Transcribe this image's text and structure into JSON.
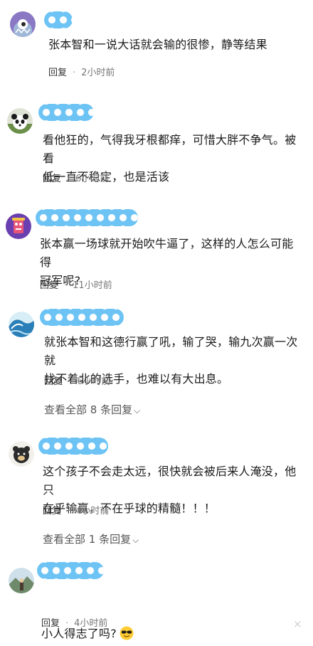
{
  "comments": [
    {
      "text": "张本智和一说大话就会输的很惨，静等结果",
      "reply": "回复",
      "sep": "·",
      "time": "2小时前",
      "avatar_icon": "monster-avatar-icon"
    },
    {
      "text": "看他狂的，气得我牙根都痒，可惜大胖不争气。被看\n低一直不稳定，也是活该",
      "reply": "回复",
      "sep": "·",
      "time": "6小时前",
      "avatar_icon": "panda-avatar-icon"
    },
    {
      "text": "张本赢一场球就开始吹牛逼了，这样的人怎么可能得\n冠军呢?",
      "reply": "回复",
      "sep": "·",
      "time": "11小时前",
      "avatar_icon": "character-avatar-icon"
    },
    {
      "text": "就张本智和这德行赢了吼，输了哭，输九次赢一次就\n找不着北的选手，也难以有大出息。",
      "reply": "回复",
      "sep": "·",
      "time": "6小时前",
      "avatar_icon": "wave-avatar-icon",
      "view_all": "查看全部 8 条回复"
    },
    {
      "text": "这个孩子不会走太远，很快就会被后来人淹没，他只\n在乎输赢，不在乎球的精髓！！！",
      "reply": "回复",
      "sep": "·",
      "time": "4小时前",
      "avatar_icon": "animal-avatar-icon",
      "view_all": "查看全部 1 条回复"
    },
    {
      "text": "小人得志了吗?",
      "reply": "回复",
      "sep": "·",
      "time": "4小时前",
      "avatar_icon": "landscape-avatar-icon",
      "emoji": "sunglasses-emoji-icon"
    }
  ],
  "close_glyph": "×",
  "chevron_glyph": "⌵",
  "colors": {
    "username_blur": "#6cc3f4",
    "meta_text": "#777777"
  }
}
